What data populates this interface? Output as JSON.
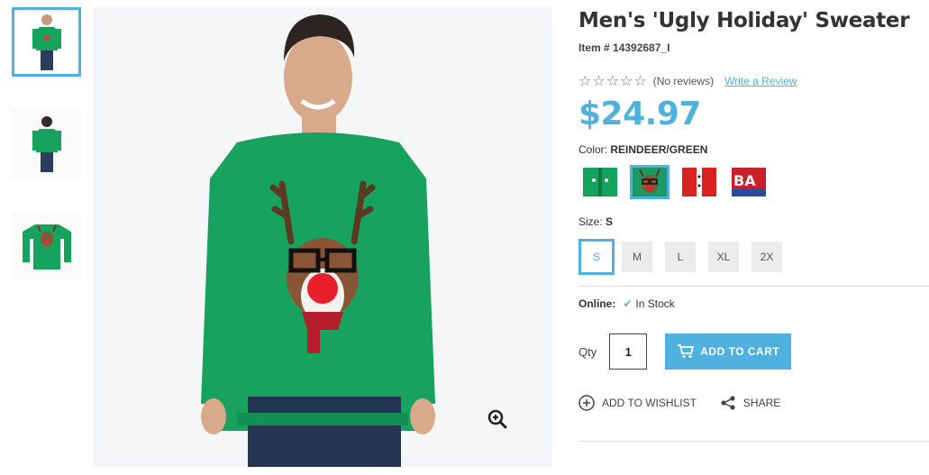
{
  "product": {
    "title": "Men's 'Ugly Holiday' Sweater",
    "item_number": "Item # 14392687_I",
    "reviews_text": "(No reviews)",
    "write_review": "Write a Review",
    "price": "$24.97",
    "rating_stars": "☆☆☆☆☆"
  },
  "color": {
    "label": "Color:",
    "selected": "REINDEER/GREEN",
    "swatches": [
      {
        "name": "elf-green",
        "color": "#14a35a"
      },
      {
        "name": "reindeer-green",
        "color": "#1d9a63"
      },
      {
        "name": "santa-red",
        "color": "#d9231f"
      },
      {
        "name": "bah-red",
        "color": "#c8202a"
      }
    ]
  },
  "size": {
    "label": "Size:",
    "selected": "S",
    "options": [
      "S",
      "M",
      "L",
      "XL",
      "2X"
    ]
  },
  "availability": {
    "label": "Online:",
    "status": "In Stock"
  },
  "cart": {
    "qty_label": "Qty",
    "qty_value": "1",
    "add_to_cart": "ADD TO CART"
  },
  "actions": {
    "wishlist": "ADD TO WISHLIST",
    "share": "SHARE"
  },
  "colors": {
    "accent": "#4fb1e0",
    "sweater": "#16a25e"
  }
}
